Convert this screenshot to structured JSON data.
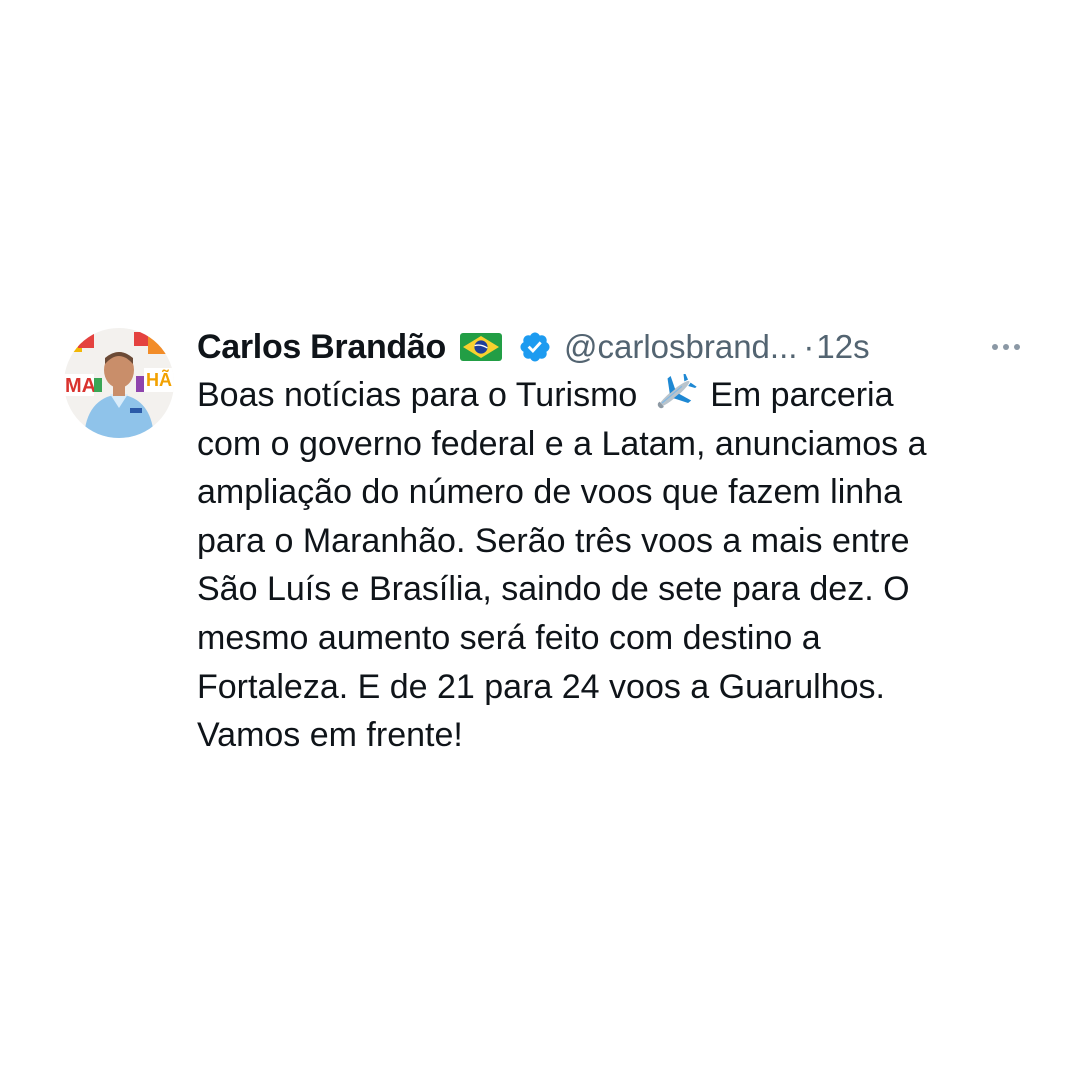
{
  "tweet": {
    "author_name": "Carlos Brandão",
    "handle": "@carlosbrand...",
    "separator": "·",
    "timestamp": "12s",
    "flag_icon": "brazil-flag-icon",
    "verified_icon": "verified-badge-icon",
    "more_icon": "more-options-icon",
    "text_lines": [
      {
        "before": "Boas notícias para o Turismo",
        "emoji": "airplane-icon",
        "after": "Em parceria"
      },
      "com o governo federal e a Latam, anunciamos a",
      "ampliação do número de voos que fazem linha",
      "para o Maranhão. Serão três voos a mais entre",
      "São Luís e Brasília, saindo de sete para dez. O",
      "mesmo aumento será feito com destino a",
      "Fortaleza. E de 21 para 24 voos a Guarulhos.",
      "Vamos em frente!"
    ]
  },
  "colors": {
    "text_primary": "#0f1419",
    "text_secondary": "#536471",
    "verified_blue": "#1d9bf0",
    "background": "#ffffff"
  }
}
